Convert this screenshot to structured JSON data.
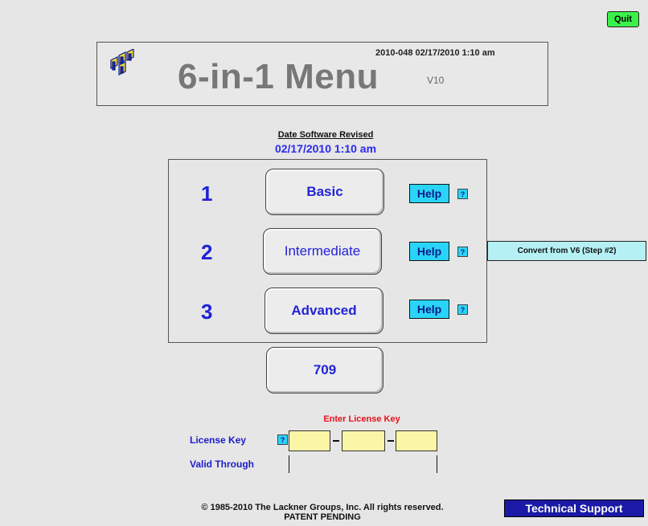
{
  "quit_label": "Quit",
  "header": {
    "title": "6-in-1 Menu",
    "version": "V10",
    "stamp": "2010-048 02/17/2010 1:10 am",
    "logo_icon": "stacked-cubes-icon"
  },
  "revised": {
    "label": "Date Software Revised",
    "value": "02/17/2010 1:10 am"
  },
  "levels": [
    {
      "number": "1",
      "label": "Basic",
      "help": "Help",
      "q": "?"
    },
    {
      "number": "2",
      "label": "Intermediate",
      "help": "Help",
      "q": "?"
    },
    {
      "number": "3",
      "label": "Advanced",
      "help": "Help",
      "q": "?"
    }
  ],
  "convert_label": "Convert from V6 (Step #2)",
  "form_709": "709",
  "license": {
    "enter_prompt": "Enter License Key",
    "key_label": "License Key",
    "valid_label": "Valid Through",
    "q": "?",
    "segments": [
      "",
      "",
      ""
    ]
  },
  "footer": {
    "copyright": "© 1985-2010 The Lackner Groups, Inc.   All rights reserved.",
    "patent": "PATENT PENDING",
    "support_label": "Technical Support"
  },
  "colors": {
    "background": "#e6e6e6",
    "quit_green": "#3cf04a",
    "help_cyan": "#2ad4f6",
    "number_blue": "#1f22d6",
    "enter_red": "#e8101a",
    "support_navy": "#1a1aa6",
    "key_yellow": "#faf6a6"
  }
}
